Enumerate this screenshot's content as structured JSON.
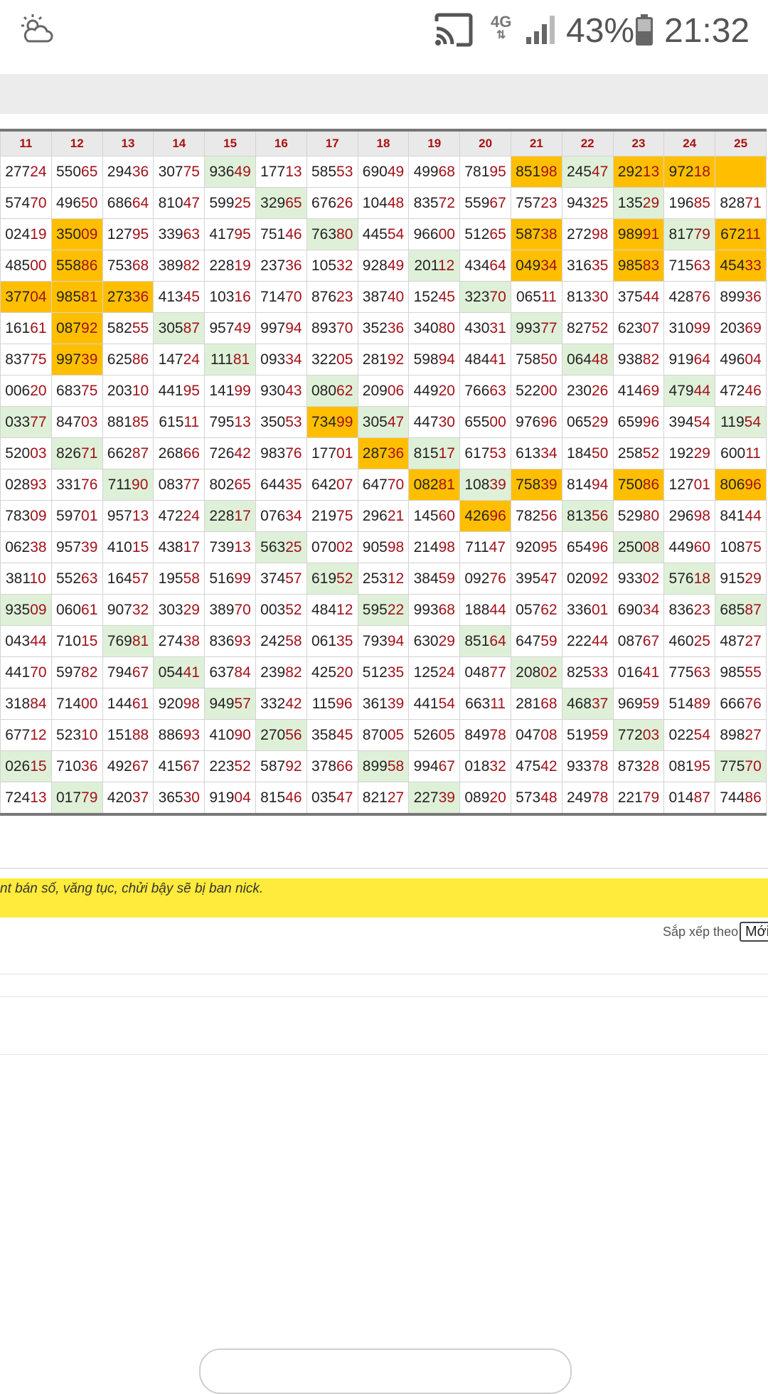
{
  "status_bar": {
    "weather_icon": "partly-cloudy-icon",
    "cast_icon": "screen-cast-icon",
    "network_type": "4G",
    "network_arrows": "⇅",
    "signal_icon": "signal-bars-icon",
    "battery_percent": "43%",
    "battery_icon": "battery-icon",
    "time": "21:32"
  },
  "table": {
    "columns": [
      "11",
      "12",
      "13",
      "14",
      "15",
      "16",
      "17",
      "18",
      "19",
      "20",
      "21",
      "22",
      "23",
      "24",
      "25"
    ],
    "rows": [
      [
        "27724",
        "55065",
        "29436",
        "30775",
        "93649",
        "17713",
        "58553",
        "69049",
        "49968",
        "78195",
        "85198",
        "24547",
        "29213",
        "97218",
        ""
      ],
      [
        "57470",
        "49650",
        "68664",
        "81047",
        "59925",
        "32965",
        "67626",
        "10448",
        "83572",
        "55967",
        "75723",
        "94325",
        "13529",
        "19685",
        "82871"
      ],
      [
        "02419",
        "35009",
        "12795",
        "33963",
        "41795",
        "75146",
        "76380",
        "44554",
        "96600",
        "51265",
        "58738",
        "27298",
        "98991",
        "81779",
        "67211"
      ],
      [
        "48500",
        "55886",
        "75368",
        "38982",
        "22819",
        "23736",
        "10532",
        "92849",
        "20112",
        "43464",
        "04934",
        "31635",
        "98583",
        "71563",
        "45433"
      ],
      [
        "37704",
        "98581",
        "27336",
        "41345",
        "10316",
        "71470",
        "87623",
        "38740",
        "15245",
        "32370",
        "06511",
        "81330",
        "37544",
        "42876",
        "89936"
      ],
      [
        "16161",
        "08792",
        "58255",
        "30587",
        "95749",
        "99794",
        "89370",
        "35236",
        "34080",
        "43031",
        "99377",
        "82752",
        "62307",
        "31099",
        "20369"
      ],
      [
        "83775",
        "99739",
        "62586",
        "14724",
        "11181",
        "09334",
        "32205",
        "28192",
        "59894",
        "48441",
        "75850",
        "06448",
        "93882",
        "91964",
        "49604"
      ],
      [
        "00620",
        "68375",
        "20310",
        "44195",
        "14199",
        "93043",
        "08062",
        "20906",
        "44920",
        "76663",
        "52200",
        "23026",
        "41469",
        "47944",
        "47246"
      ],
      [
        "03377",
        "84703",
        "88185",
        "61511",
        "79513",
        "35053",
        "73499",
        "30547",
        "44730",
        "65500",
        "97696",
        "06529",
        "65996",
        "39454",
        "11954"
      ],
      [
        "52003",
        "82671",
        "66287",
        "26866",
        "72642",
        "98376",
        "17701",
        "28736",
        "81517",
        "61753",
        "61334",
        "18450",
        "25852",
        "19229",
        "60011"
      ],
      [
        "02893",
        "33176",
        "71190",
        "08377",
        "80265",
        "64435",
        "64207",
        "64770",
        "08281",
        "10839",
        "75839",
        "81494",
        "75086",
        "12701",
        "80696"
      ],
      [
        "78309",
        "59701",
        "95713",
        "47224",
        "22817",
        "07634",
        "21975",
        "29621",
        "14560",
        "42696",
        "78256",
        "81356",
        "52980",
        "29698",
        "84144"
      ],
      [
        "06238",
        "95739",
        "41015",
        "43817",
        "73913",
        "56325",
        "07002",
        "90598",
        "21498",
        "71147",
        "92095",
        "65496",
        "25008",
        "44960",
        "10875"
      ],
      [
        "38110",
        "55263",
        "16457",
        "19558",
        "51699",
        "37457",
        "61952",
        "25312",
        "38459",
        "09276",
        "39547",
        "02092",
        "93302",
        "57618",
        "91529"
      ],
      [
        "93509",
        "06061",
        "90732",
        "30329",
        "38970",
        "00352",
        "48412",
        "59522",
        "99368",
        "18844",
        "05762",
        "33601",
        "69034",
        "83623",
        "68587"
      ],
      [
        "04344",
        "71015",
        "76981",
        "27438",
        "83693",
        "24258",
        "06135",
        "79394",
        "63029",
        "85164",
        "64759",
        "22244",
        "08767",
        "46025",
        "48727"
      ],
      [
        "44170",
        "59782",
        "79467",
        "05441",
        "63784",
        "23982",
        "42520",
        "51235",
        "12524",
        "04877",
        "20802",
        "82533",
        "01641",
        "77563",
        "98555"
      ],
      [
        "31884",
        "71400",
        "14461",
        "92098",
        "94957",
        "33242",
        "11596",
        "36139",
        "44154",
        "66311",
        "28168",
        "46837",
        "96959",
        "51489",
        "66676"
      ],
      [
        "67712",
        "52310",
        "15188",
        "88693",
        "41090",
        "27056",
        "35845",
        "87005",
        "52605",
        "84978",
        "04708",
        "51959",
        "77203",
        "02254",
        "89827"
      ],
      [
        "02615",
        "71036",
        "49267",
        "41567",
        "22352",
        "58792",
        "37866",
        "89958",
        "99467",
        "01832",
        "47542",
        "93378",
        "87328",
        "08195",
        "77570"
      ],
      [
        "72413",
        "01779",
        "42037",
        "36530",
        "91904",
        "81546",
        "03547",
        "82127",
        "22739",
        "08920",
        "57348",
        "24978",
        "22179",
        "01487",
        "74486"
      ]
    ],
    "highlight_orange": [
      [
        0,
        10
      ],
      [
        0,
        12
      ],
      [
        0,
        13
      ],
      [
        0,
        14
      ],
      [
        2,
        1
      ],
      [
        2,
        10
      ],
      [
        2,
        12
      ],
      [
        2,
        14
      ],
      [
        3,
        1
      ],
      [
        3,
        10
      ],
      [
        3,
        12
      ],
      [
        3,
        14
      ],
      [
        4,
        0
      ],
      [
        4,
        1
      ],
      [
        4,
        2
      ],
      [
        5,
        1
      ],
      [
        6,
        1
      ],
      [
        8,
        6
      ],
      [
        9,
        7
      ],
      [
        10,
        8
      ],
      [
        10,
        10
      ],
      [
        10,
        12
      ],
      [
        10,
        14
      ],
      [
        11,
        9
      ]
    ],
    "highlight_green": [
      [
        0,
        4
      ],
      [
        0,
        11
      ],
      [
        1,
        5
      ],
      [
        1,
        12
      ],
      [
        2,
        6
      ],
      [
        2,
        13
      ],
      [
        3,
        8
      ],
      [
        4,
        9
      ],
      [
        5,
        3
      ],
      [
        5,
        10
      ],
      [
        6,
        4
      ],
      [
        6,
        11
      ],
      [
        7,
        6
      ],
      [
        7,
        13
      ],
      [
        8,
        0
      ],
      [
        8,
        7
      ],
      [
        8,
        14
      ],
      [
        9,
        1
      ],
      [
        9,
        8
      ],
      [
        10,
        2
      ],
      [
        10,
        9
      ],
      [
        11,
        4
      ],
      [
        11,
        11
      ],
      [
        12,
        5
      ],
      [
        12,
        12
      ],
      [
        13,
        6
      ],
      [
        13,
        13
      ],
      [
        14,
        0
      ],
      [
        14,
        7
      ],
      [
        14,
        14
      ],
      [
        15,
        2
      ],
      [
        15,
        9
      ],
      [
        16,
        3
      ],
      [
        16,
        10
      ],
      [
        17,
        4
      ],
      [
        17,
        11
      ],
      [
        18,
        5
      ],
      [
        18,
        12
      ],
      [
        19,
        0
      ],
      [
        19,
        7
      ],
      [
        19,
        14
      ],
      [
        20,
        1
      ],
      [
        20,
        8
      ]
    ],
    "colors": {
      "orange": "#ffbf00",
      "green": "#dff0d8",
      "digit_red": "#a3111a",
      "header_text": "#aa1111"
    }
  },
  "notice": {
    "text": "nt bán số, văng tục, chửi bậy sẽ bị ban nick."
  },
  "sort": {
    "label": "Sắp xếp theo",
    "selected": "Mới"
  }
}
